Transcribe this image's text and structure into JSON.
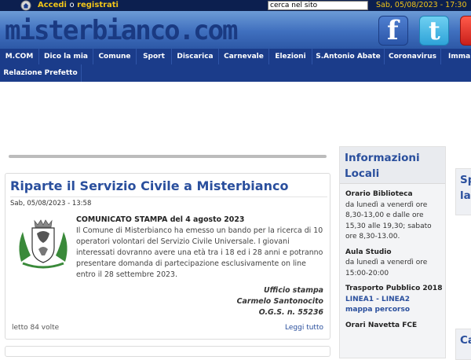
{
  "header": {
    "login_link": "Accedi",
    "login_sep": "o",
    "register_link": "registrati",
    "search_placeholder": "cerca nel sito",
    "datetime": "Sab, 05/08/2023 - 17:30",
    "logo_text": "misterbianco.com",
    "social": {
      "facebook": "f",
      "twitter": "t"
    }
  },
  "nav": {
    "items": [
      "M.COM",
      "Dico la mia",
      "Comune",
      "Sport",
      "Discarica",
      "Carnevale",
      "Elezioni",
      "S.Antonio Abate",
      "Coronavirus",
      "Imma"
    ],
    "row2": [
      "Relazione Prefetto"
    ]
  },
  "article": {
    "title": "Riparte il Servizio Civile a Misterbianco",
    "date": "Sab, 05/08/2023 - 13:58",
    "headline": "COMUNICATO STAMPA del 4 agosto 2023",
    "body": "Il Comune di Misterbianco ha emesso un bando per la ricerca di 10 operatori volontari del Servizio Civile Universale. I giovani interessati dovranno avere una età tra i 18 ed i 28 anni e potranno presentare domanda di partecipazione esclusivamente on line entro il 28 settembre 2023.",
    "signature": [
      "Ufficio stampa",
      "Carmelo Santonocito",
      "O.G.S. n. 55236"
    ],
    "views": "letto 84 volte",
    "read_more": "Leggi tutto"
  },
  "sidebar": {
    "title": "Informazioni Locali",
    "blocks": [
      {
        "title": "Orario Biblioteca",
        "text": "da lunedì a venerdì ore 8,30-13,00 e dalle ore 15,30 alle 19,30; sabato ore 8,30-13.00."
      },
      {
        "title": "Aula Studio",
        "text": "da lunedì a venerdì ore 15:00-20:00"
      },
      {
        "title": "Trasporto Pubblico 2018",
        "link": "LINEA1 - LINEA2",
        "link2": "mappa percorso"
      },
      {
        "title": "Orari Navetta FCE"
      }
    ]
  },
  "edge": {
    "box1": "Sp la",
    "box2": "Ca"
  },
  "colors": {
    "brand_blue": "#1b3c8a",
    "accent_yellow": "#f0c419",
    "title_blue": "#2a4f9d"
  }
}
